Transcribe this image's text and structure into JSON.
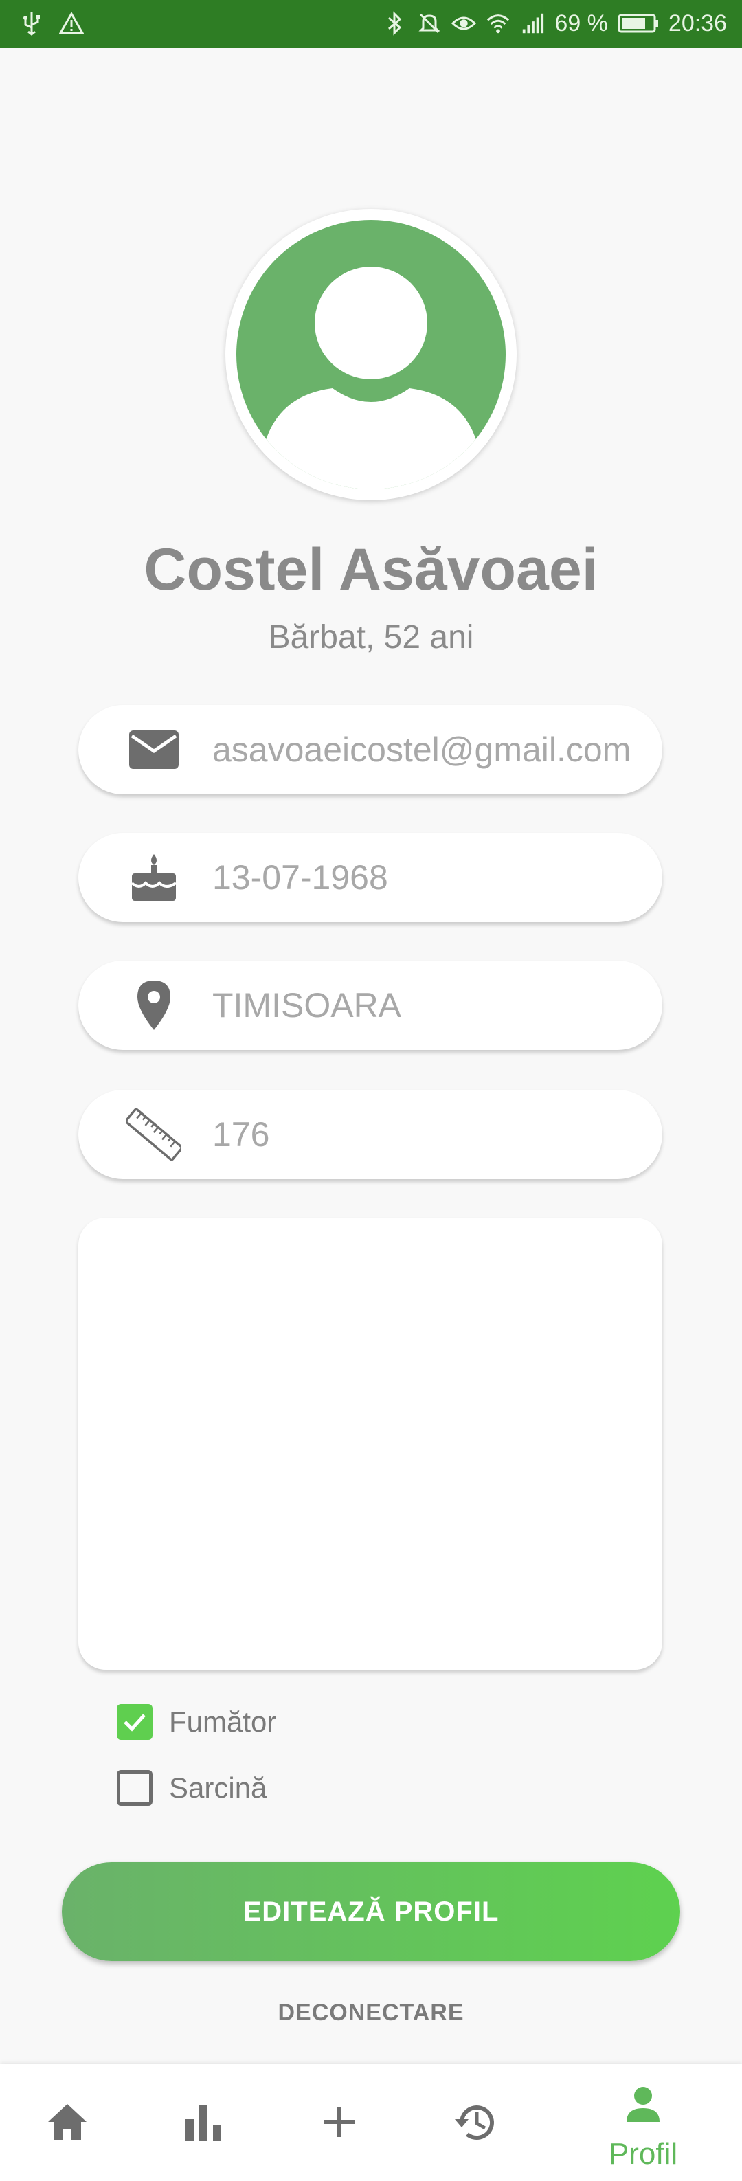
{
  "status_bar": {
    "battery_percent": "69 %",
    "time": "20:36",
    "icons": [
      "usb-icon",
      "warning-icon",
      "bluetooth-icon",
      "mute-icon",
      "eye-icon",
      "wifi-icon",
      "signal-icon",
      "battery-icon"
    ]
  },
  "profile": {
    "name": "Costel Asăvoaei",
    "subtitle": "Bărbat, 52 ani",
    "avatar_icon": "person-avatar-icon",
    "avatar_color": "#6ab26a"
  },
  "fields": {
    "email": {
      "icon": "email-icon",
      "value": "asavoaeicostel@gmail.com"
    },
    "birthdate": {
      "icon": "cake-icon",
      "value": "13-07-1968"
    },
    "location": {
      "icon": "location-pin-icon",
      "value": "TIMISOARA"
    },
    "height": {
      "icon": "ruler-icon",
      "value": "176"
    },
    "notes": {
      "value": ""
    }
  },
  "checkboxes": {
    "smoker": {
      "label": "Fumător",
      "checked": true
    },
    "pregnancy": {
      "label": "Sarcină",
      "checked": false
    }
  },
  "actions": {
    "edit_profile": "EDITEAZĂ PROFIL",
    "logout": "DECONECTARE"
  },
  "bottom_nav": {
    "items": [
      {
        "icon": "home-icon",
        "label": ""
      },
      {
        "icon": "bar-chart-icon",
        "label": ""
      },
      {
        "icon": "plus-icon",
        "label": ""
      },
      {
        "icon": "history-icon",
        "label": ""
      },
      {
        "icon": "person-icon",
        "label": "Profil",
        "active": true
      }
    ],
    "active_color": "#5fb85a",
    "inactive_color": "#6d6d6d"
  },
  "colors": {
    "accent": "#5ed14f",
    "status_bar": "#2e7d24",
    "text_muted": "#8a8a8a"
  }
}
